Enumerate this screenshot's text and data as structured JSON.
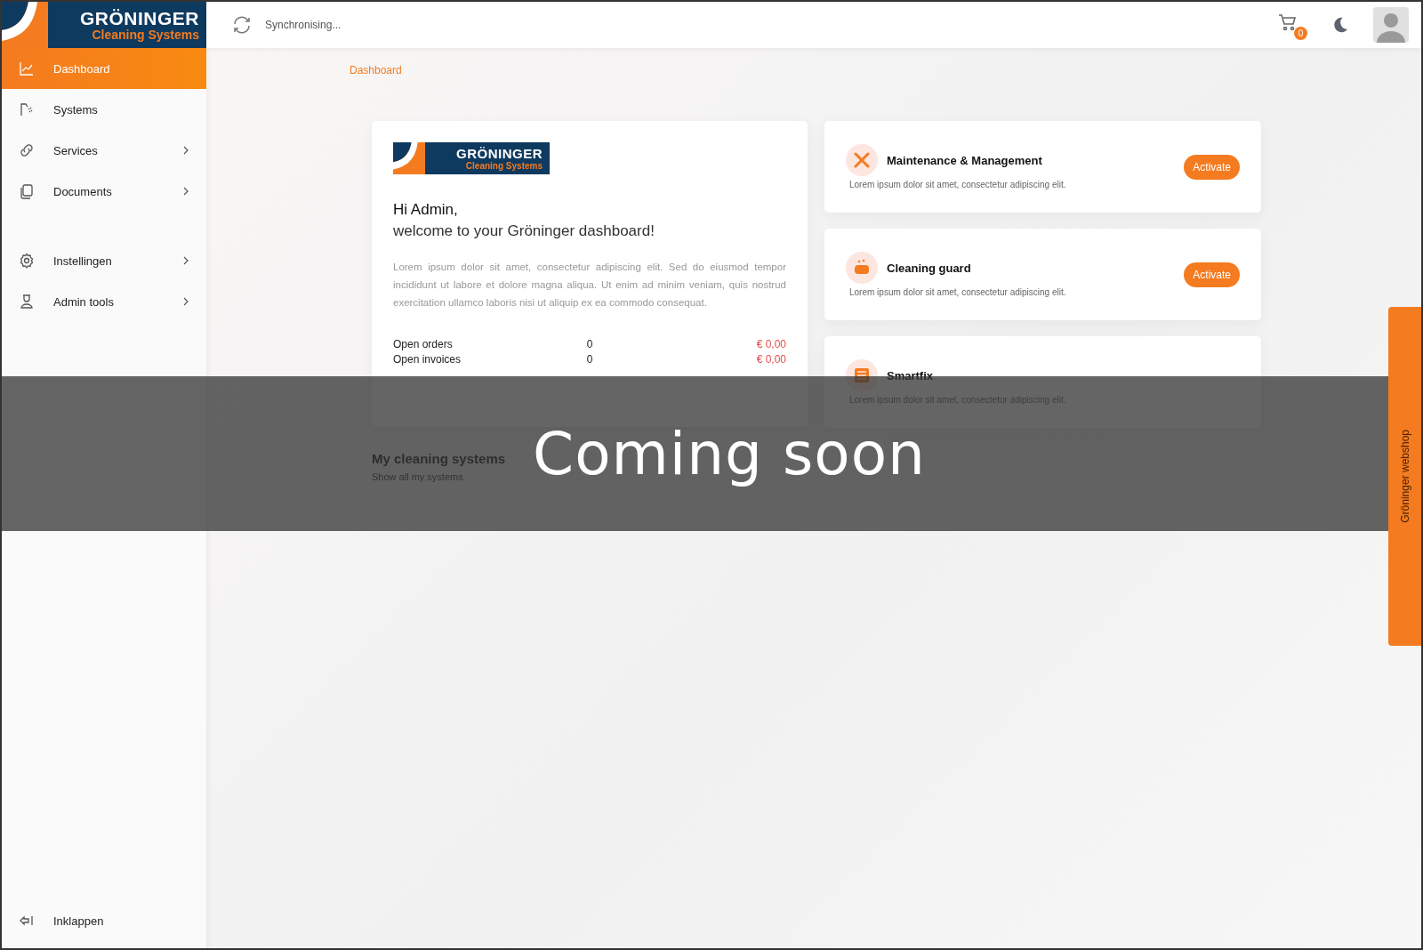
{
  "logo": {
    "name": "GRÖNINGER",
    "tagline": "Cleaning Systems"
  },
  "topbar": {
    "sync_status": "Synchronising...",
    "cart_count": "0"
  },
  "sidebar": {
    "sections": [
      {
        "items": [
          {
            "label": "Dashboard",
            "selected": true,
            "has_submenu": false
          },
          {
            "label": "Systems",
            "selected": false,
            "has_submenu": false
          },
          {
            "label": "Services",
            "selected": false,
            "has_submenu": true
          },
          {
            "label": "Documents",
            "selected": false,
            "has_submenu": true
          }
        ]
      },
      {
        "items": [
          {
            "label": "Instellingen",
            "selected": false,
            "has_submenu": true
          },
          {
            "label": "Admin tools",
            "selected": false,
            "has_submenu": true
          }
        ]
      }
    ],
    "collapse": "Inklappen"
  },
  "breadcrumb": "Dashboard",
  "welcome": {
    "logo": {
      "name": "GRÖNINGER",
      "tagline": "Cleaning Systems"
    },
    "greeting": "Hi Admin,",
    "subtitle": "welcome to your Gröninger dashboard!",
    "body": "Lorem ipsum dolor sit amet, consectetur adipiscing elit. Sed do eiusmod tempor incididunt ut labore et dolore magna aliqua. Ut enim ad minim veniam, quis nostrud exercitation ullamco laboris nisi ut aliquip ex ea commodo consequat.",
    "stats": [
      {
        "label": "Open orders",
        "count": "0",
        "amount": "€ 0,00"
      },
      {
        "label": "Open invoices",
        "count": "0",
        "amount": "€ 0,00"
      }
    ]
  },
  "services": [
    {
      "title": "Maintenance & Management",
      "description": "Lorem ipsum dolor sit amet, consectetur adipiscing elit.",
      "button": "Activate"
    },
    {
      "title": "Cleaning guard",
      "description": "Lorem ipsum dolor sit amet, consectetur adipiscing elit.",
      "button": "Activate"
    },
    {
      "title": "Smartfix",
      "description": "Lorem ipsum dolor sit amet, consectetur adipiscing elit."
    }
  ],
  "systems": {
    "title": "My cleaning systems",
    "link": "Show all my systems"
  },
  "overlay": {
    "text": "Coming soon"
  },
  "webshop_tab": "Gröninger webshop"
}
